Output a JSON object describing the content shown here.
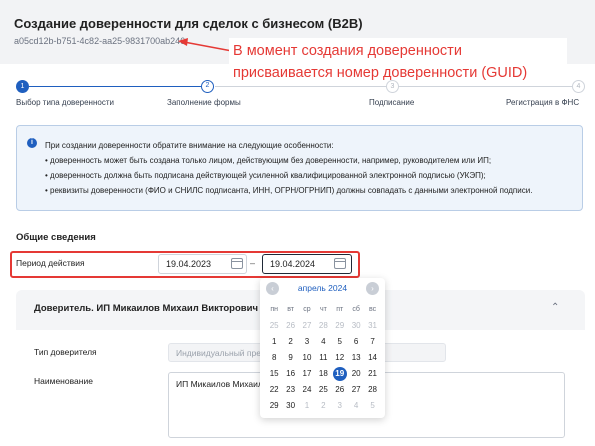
{
  "header": {
    "title": "Создание доверенности для сделок с бизнесом (B2B)",
    "guid": "a05cd12b-b751-4c82-aa25-9831700ab246"
  },
  "annotation": {
    "line1": "В момент создания доверенности",
    "line2": "присваивается номер доверенности (GUID)"
  },
  "steps": [
    {
      "num": "1",
      "label": "Выбор типа доверенности",
      "state": "active"
    },
    {
      "num": "2",
      "label": "Заполнение формы",
      "state": "current"
    },
    {
      "num": "3",
      "label": "Подписание",
      "state": "todo"
    },
    {
      "num": "4",
      "label": "Регистрация в ФНС",
      "state": "todo"
    }
  ],
  "info": {
    "intro": "При создании доверенности обратите внимание на следующие особенности:",
    "items": [
      "• доверенность может быть создана только лицом, действующим без доверенности, например, руководителем или ИП;",
      "• доверенность должна быть подписана действующей усиленной квалифицированной электронной подписью (УКЭП);",
      "• реквизиты доверенности (ФИО и СНИЛС подписанта, ИНН, ОГРН/ОГРНИП) должны совпадать с данными электронной подписи."
    ]
  },
  "general": {
    "section_title": "Общие сведения",
    "period_label": "Период действия",
    "date_from": "19.04.2023",
    "date_to": "19.04.2024",
    "dash": "–"
  },
  "calendar": {
    "month": "апрель 2024",
    "prev": "‹",
    "next": "›",
    "dow": [
      "пн",
      "вт",
      "ср",
      "чт",
      "пт",
      "сб",
      "вс"
    ],
    "weeks": [
      [
        [
          "25",
          "other"
        ],
        [
          "26",
          "other"
        ],
        [
          "27",
          "other"
        ],
        [
          "28",
          "other"
        ],
        [
          "29",
          "other"
        ],
        [
          "30",
          "other"
        ],
        [
          "31",
          "other"
        ]
      ],
      [
        [
          "1",
          ""
        ],
        [
          "2",
          ""
        ],
        [
          "3",
          ""
        ],
        [
          "4",
          ""
        ],
        [
          "5",
          ""
        ],
        [
          "6",
          ""
        ],
        [
          "7",
          ""
        ]
      ],
      [
        [
          "8",
          ""
        ],
        [
          "9",
          ""
        ],
        [
          "10",
          ""
        ],
        [
          "11",
          ""
        ],
        [
          "12",
          ""
        ],
        [
          "13",
          ""
        ],
        [
          "14",
          ""
        ]
      ],
      [
        [
          "15",
          ""
        ],
        [
          "16",
          ""
        ],
        [
          "17",
          ""
        ],
        [
          "18",
          ""
        ],
        [
          "19",
          "sel"
        ],
        [
          "20",
          ""
        ],
        [
          "21",
          ""
        ]
      ],
      [
        [
          "22",
          ""
        ],
        [
          "23",
          ""
        ],
        [
          "24",
          ""
        ],
        [
          "25",
          ""
        ],
        [
          "26",
          ""
        ],
        [
          "27",
          ""
        ],
        [
          "28",
          ""
        ]
      ],
      [
        [
          "29",
          ""
        ],
        [
          "30",
          ""
        ],
        [
          "1",
          "other"
        ],
        [
          "2",
          "other"
        ],
        [
          "3",
          "other"
        ],
        [
          "4",
          "other"
        ],
        [
          "5",
          "other"
        ]
      ]
    ]
  },
  "principal": {
    "title": "Доверитель. ИП Микаилов Михаил Викторович",
    "type_label": "Тип доверителя",
    "type_value": "Индивидуальный пре",
    "name_label": "Наименование",
    "name_value": "ИП Микаилов Михаил"
  },
  "colors": {
    "accent": "#1f5fbf",
    "annotation_red": "#e53935"
  }
}
